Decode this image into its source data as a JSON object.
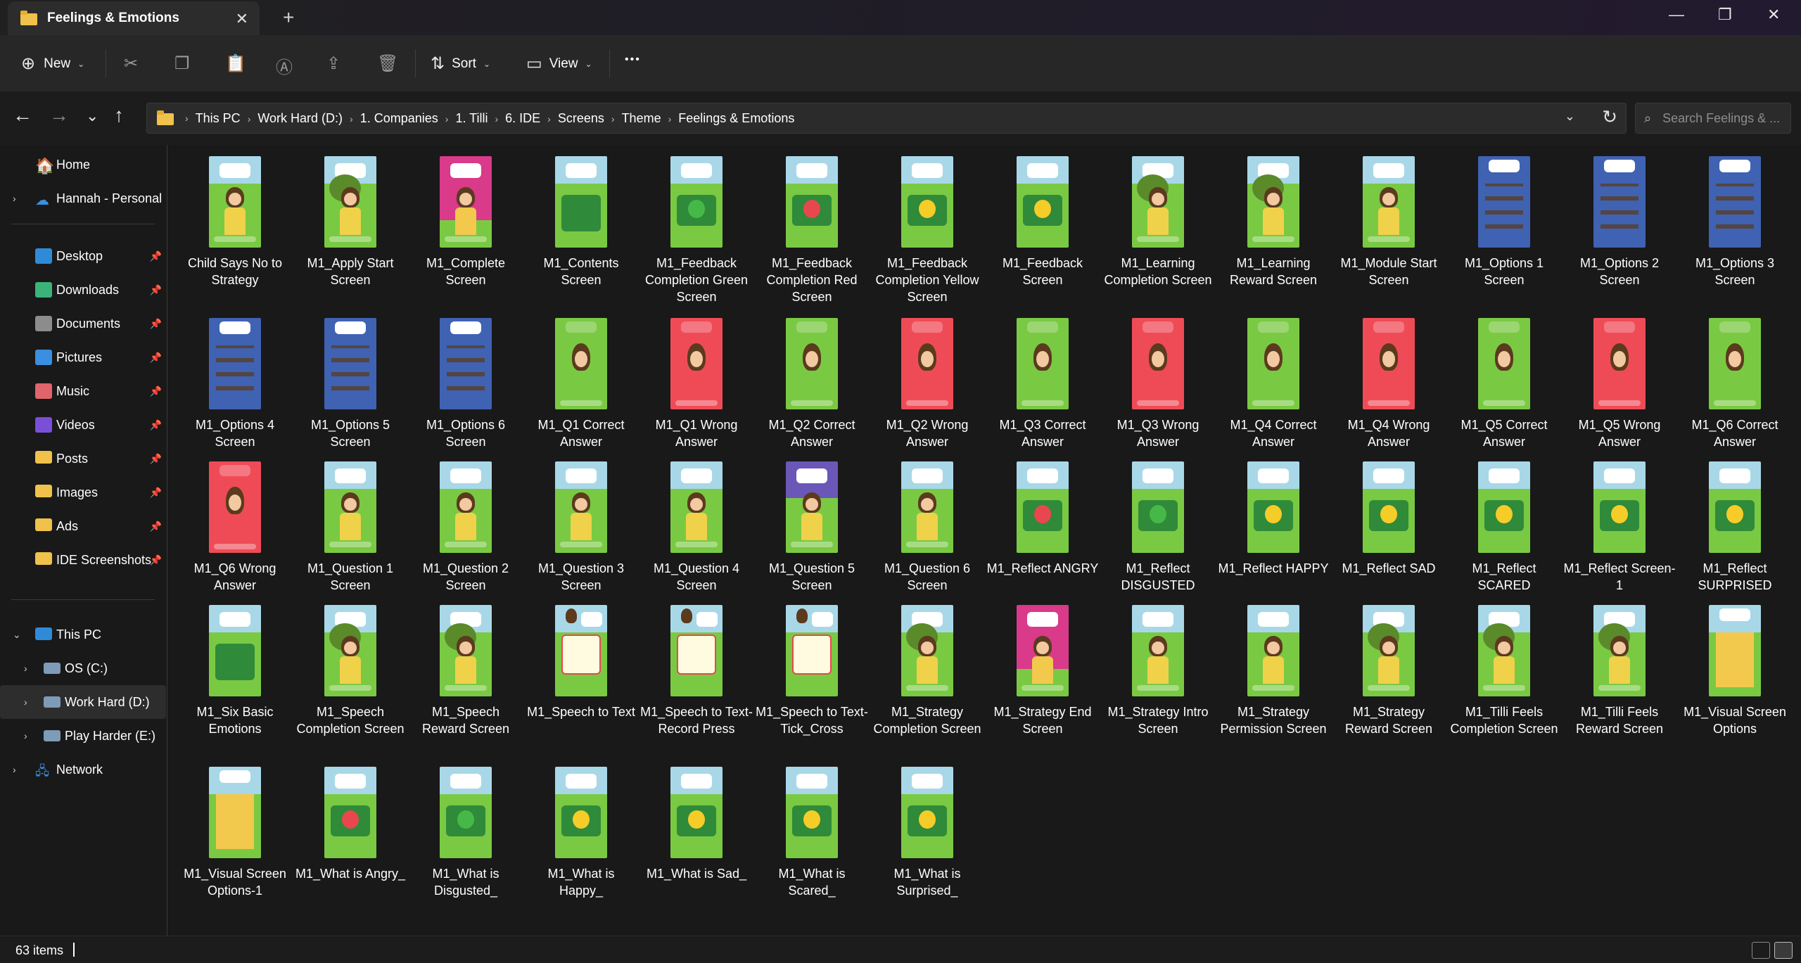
{
  "window": {
    "tab_title": "Feelings & Emotions",
    "close_tab": "✕",
    "new_tab": "+",
    "minimize": "—",
    "maximize": "❐",
    "close": "✕"
  },
  "toolbar": {
    "new_label": "New",
    "sort_label": "Sort",
    "view_label": "View",
    "more_label": "•••",
    "icons": [
      "plus-circle-icon",
      "cut-icon",
      "copy-icon",
      "paste-icon",
      "rename-icon",
      "share-icon",
      "delete-icon",
      "sort-icon",
      "view-icon",
      "more-icon"
    ]
  },
  "address": {
    "back": "←",
    "forward": "→",
    "recent": "⌄",
    "up": "↑",
    "breadcrumbs": [
      "This PC",
      "Work Hard (D:)",
      "1. Companies",
      "1. Tilli",
      "6. IDE",
      "Screens",
      "Theme",
      "Feelings & Emotions"
    ],
    "search_placeholder": "Search Feelings & ..."
  },
  "sidebar": {
    "home": "Home",
    "cloud": "Hannah - Personal",
    "quick": [
      {
        "label": "Desktop",
        "icon": "desktop-icon",
        "color": "#2f8bd8"
      },
      {
        "label": "Downloads",
        "icon": "download-icon",
        "color": "#3bb37a"
      },
      {
        "label": "Documents",
        "icon": "document-icon",
        "color": "#8c8c8c"
      },
      {
        "label": "Pictures",
        "icon": "pictures-icon",
        "color": "#3a8fe0"
      },
      {
        "label": "Music",
        "icon": "music-icon",
        "color": "#e0646c"
      },
      {
        "label": "Videos",
        "icon": "videos-icon",
        "color": "#7a4fd8"
      },
      {
        "label": "Posts",
        "icon": "folder-icon",
        "color": "#f0c24b"
      },
      {
        "label": "Images",
        "icon": "folder-icon",
        "color": "#f0c24b"
      },
      {
        "label": "Ads",
        "icon": "folder-icon",
        "color": "#f0c24b"
      },
      {
        "label": "IDE Screenshots",
        "icon": "folder-icon",
        "color": "#f0c24b"
      }
    ],
    "this_pc": "This PC",
    "drives": [
      "OS (C:)",
      "Work Hard (D:)",
      "Play Harder (E:)"
    ],
    "network": "Network"
  },
  "files": [
    {
      "name": "Child Says No to Strategy",
      "theme": "green-char"
    },
    {
      "name": "M1_Apply Start Screen",
      "theme": "green-tree"
    },
    {
      "name": "M1_Complete Screen",
      "theme": "pink-complete"
    },
    {
      "name": "M1_Contents Screen",
      "theme": "green-panel"
    },
    {
      "name": "M1_Feedback Completion Green Screen",
      "theme": "green-emoji-g"
    },
    {
      "name": "M1_Feedback Completion Red Screen",
      "theme": "green-emoji-r"
    },
    {
      "name": "M1_Feedback Completion Yellow Screen",
      "theme": "green-emoji-y"
    },
    {
      "name": "M1_Feedback Screen",
      "theme": "green-emoji-3"
    },
    {
      "name": "M1_Learning Completion Screen",
      "theme": "green-tree"
    },
    {
      "name": "M1_Learning Reward Screen",
      "theme": "green-tree"
    },
    {
      "name": "M1_Module Start Screen",
      "theme": "green-char"
    },
    {
      "name": "M1_Options 1 Screen",
      "theme": "blue-grid"
    },
    {
      "name": "M1_Options 2 Screen",
      "theme": "blue-grid"
    },
    {
      "name": "M1_Options 3 Screen",
      "theme": "blue-grid"
    },
    {
      "name": "M1_Options 4 Screen",
      "theme": "blue-grid"
    },
    {
      "name": "M1_Options 5 Screen",
      "theme": "blue-grid"
    },
    {
      "name": "M1_Options 6 Screen",
      "theme": "blue-grid"
    },
    {
      "name": "M1_Q1 Correct Answer",
      "theme": "green-answer"
    },
    {
      "name": "M1_Q1 Wrong Answer",
      "theme": "red-answer"
    },
    {
      "name": "M1_Q2 Correct Answer",
      "theme": "green-answer"
    },
    {
      "name": "M1_Q2 Wrong Answer",
      "theme": "red-answer"
    },
    {
      "name": "M1_Q3 Correct Answer",
      "theme": "green-answer"
    },
    {
      "name": "M1_Q3 Wrong Answer",
      "theme": "red-answer"
    },
    {
      "name": "M1_Q4 Correct Answer",
      "theme": "green-answer"
    },
    {
      "name": "M1_Q4 Wrong Answer",
      "theme": "red-answer"
    },
    {
      "name": "M1_Q5 Correct Answer",
      "theme": "green-answer"
    },
    {
      "name": "M1_Q5 Wrong Answer",
      "theme": "red-answer"
    },
    {
      "name": "M1_Q6 Correct Answer",
      "theme": "green-answer"
    },
    {
      "name": "M1_Q6 Wrong Answer",
      "theme": "red-answer"
    },
    {
      "name": "M1_Question 1 Screen",
      "theme": "green-char"
    },
    {
      "name": "M1_Question 2 Screen",
      "theme": "green-char"
    },
    {
      "name": "M1_Question 3 Screen",
      "theme": "green-char"
    },
    {
      "name": "M1_Question 4 Screen",
      "theme": "green-char"
    },
    {
      "name": "M1_Question 5 Screen",
      "theme": "purple-char"
    },
    {
      "name": "M1_Question 6 Screen",
      "theme": "green-char"
    },
    {
      "name": "M1_Reflect ANGRY",
      "theme": "green-emoji-r"
    },
    {
      "name": "M1_Reflect DISGUSTED",
      "theme": "green-emoji-g"
    },
    {
      "name": "M1_Reflect HAPPY",
      "theme": "green-emoji-y"
    },
    {
      "name": "M1_Reflect SAD",
      "theme": "green-emoji-y"
    },
    {
      "name": "M1_Reflect SCARED",
      "theme": "green-emoji-y"
    },
    {
      "name": "M1_Reflect Screen-1",
      "theme": "green-emoji-3"
    },
    {
      "name": "M1_Reflect SURPRISED",
      "theme": "green-emoji-y"
    },
    {
      "name": "M1_Six Basic Emotions",
      "theme": "green-panel"
    },
    {
      "name": "M1_Speech Completion Screen",
      "theme": "green-tree"
    },
    {
      "name": "M1_Speech Reward Screen",
      "theme": "green-tree"
    },
    {
      "name": "M1_Speech to Text",
      "theme": "green-white"
    },
    {
      "name": "M1_Speech to Text-Record Press",
      "theme": "green-white"
    },
    {
      "name": "M1_Speech to Text-Tick_Cross",
      "theme": "green-white"
    },
    {
      "name": "M1_Strategy Completion Screen",
      "theme": "green-tree"
    },
    {
      "name": "M1_Strategy End Screen",
      "theme": "pink-complete"
    },
    {
      "name": "M1_Strategy Intro Screen",
      "theme": "green-char"
    },
    {
      "name": "M1_Strategy Permission Screen",
      "theme": "green-char"
    },
    {
      "name": "M1_Strategy Reward Screen",
      "theme": "green-tree"
    },
    {
      "name": "M1_Tilli Feels Completion Screen",
      "theme": "green-tree"
    },
    {
      "name": "M1_Tilli Feels Reward Screen",
      "theme": "green-tree"
    },
    {
      "name": "M1_Visual Screen Options",
      "theme": "yellow-grid"
    },
    {
      "name": "M1_Visual Screen Options-1",
      "theme": "yellow-grid"
    },
    {
      "name": "M1_What is Angry_",
      "theme": "green-emoji-r"
    },
    {
      "name": "M1_What is Disgusted_",
      "theme": "green-emoji-g"
    },
    {
      "name": "M1_What is Happy_",
      "theme": "green-emoji-y"
    },
    {
      "name": "M1_What is Sad_",
      "theme": "green-emoji-y"
    },
    {
      "name": "M1_What is Scared_",
      "theme": "green-emoji-y"
    },
    {
      "name": "M1_What is Surprised_",
      "theme": "green-emoji-y"
    }
  ],
  "status": {
    "item_count": "63 items"
  },
  "colors": {
    "grass": "#7ac943",
    "sky": "#a8d8e8",
    "blue": "#3f62b3",
    "red": "#ef4b57",
    "pink": "#d93a8a",
    "purple": "#6a57b8",
    "yellow": "#f2c94c"
  }
}
